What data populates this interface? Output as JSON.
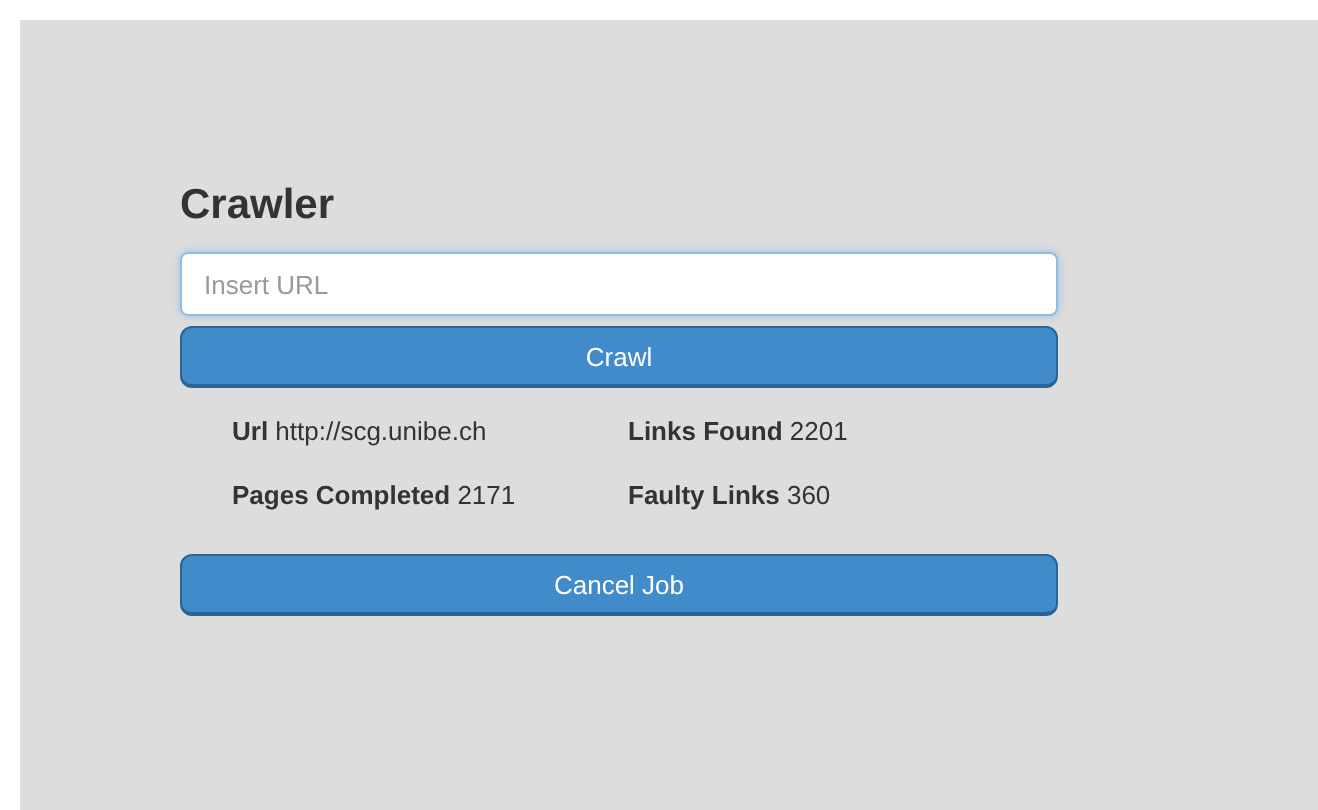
{
  "title": "Crawler",
  "url_field": {
    "placeholder": "Insert URL"
  },
  "crawl_button": "Crawl",
  "stats": [
    {
      "text": "**Url** http://scg.unibe.ch"
    },
    {
      "text": "**Links Found** 2201"
    },
    {
      "text": "**Pages Completed** 2171"
    },
    {
      "text": "**Faulty Links** 360"
    }
  ],
  "cancel_button": "Cancel Job"
}
